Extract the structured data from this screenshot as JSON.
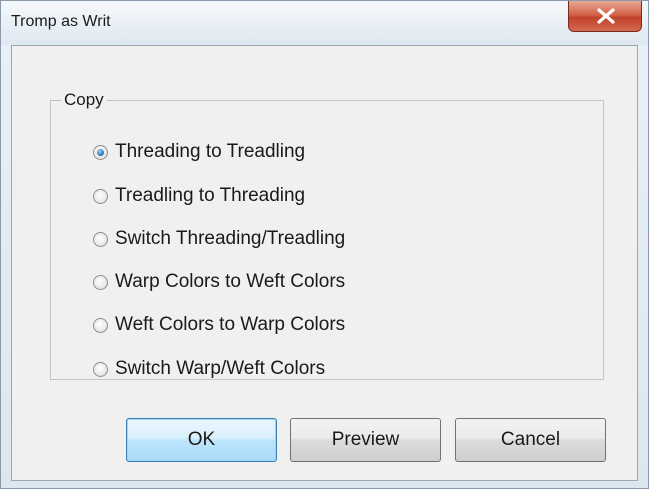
{
  "window": {
    "title": "Tromp as Writ",
    "close_label": "X"
  },
  "group": {
    "label": "Copy",
    "selected_index": 0,
    "options": [
      {
        "label": "Threading to Treadling",
        "checked": true
      },
      {
        "label": "Treadling to Threading",
        "checked": false
      },
      {
        "label": "Switch Threading/Treadling",
        "checked": false
      },
      {
        "label": "Warp Colors to Weft Colors",
        "checked": false
      },
      {
        "label": "Weft Colors to Warp Colors",
        "checked": false
      },
      {
        "label": "Switch Warp/Weft Colors",
        "checked": false
      }
    ]
  },
  "buttons": {
    "ok": "OK",
    "preview": "Preview",
    "cancel": "Cancel"
  },
  "colors": {
    "accent": "#3c7fb1",
    "close_button": "#c1412a"
  }
}
